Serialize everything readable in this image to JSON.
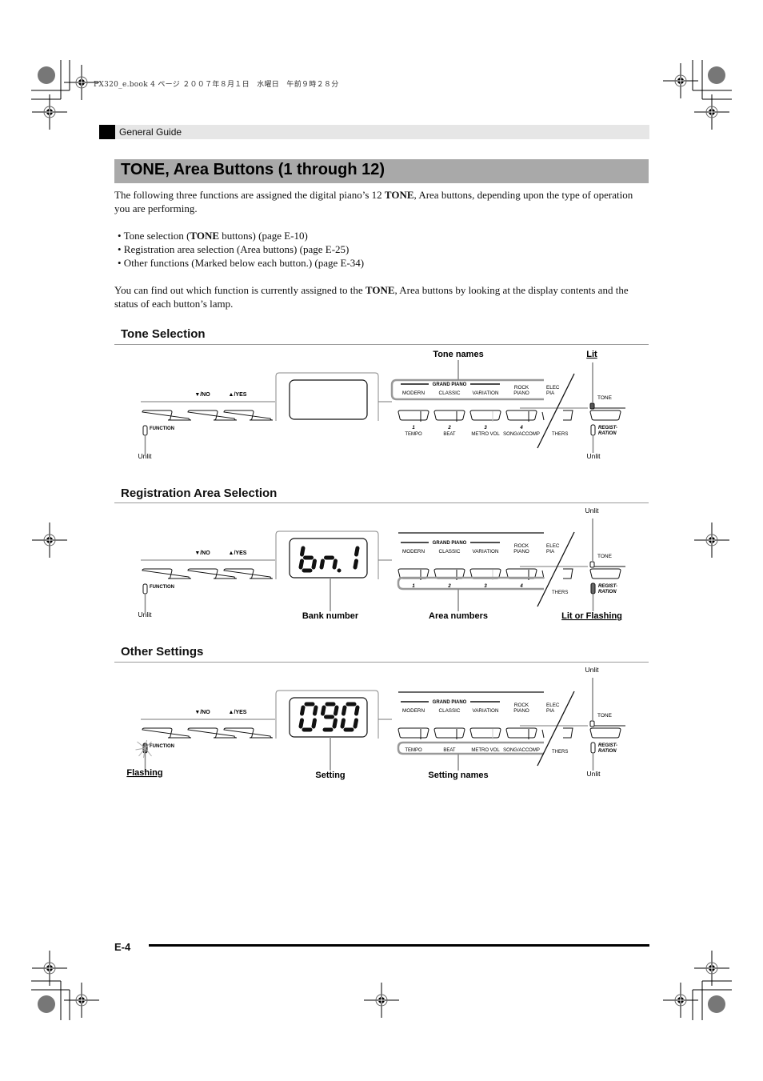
{
  "print_header": "PX320_e.book  4 ページ  ２００７年８月１日　水曜日　午前９時２８分",
  "section_label": "General Guide",
  "title": "TONE, Area Buttons (1 through 12)",
  "intro": {
    "part1": "The following three functions are assigned the digital piano’s 12 ",
    "bold": "TONE",
    "part2": ", Area buttons, depending upon the type of operation you are performing."
  },
  "bullets": [
    {
      "pre": "• Tone selection (",
      "bold": "TONE",
      "post": " buttons) (page E-10)"
    },
    {
      "pre": "• Registration area selection (Area buttons) (page E-25)",
      "bold": "",
      "post": ""
    },
    {
      "pre": "• Other functions (Marked below each button.) (page E-34)",
      "bold": "",
      "post": ""
    }
  ],
  "outro": {
    "part1": "You can find out which function is currently assigned to the ",
    "bold": "TONE",
    "part2": ", Area buttons by looking at the display contents and the status of each button’s lamp."
  },
  "panel": {
    "no_label": "▼/NO",
    "yes_label": "▲/YES",
    "function_label": "FUNCTION",
    "tone_label": "TONE",
    "regist_label_1": "REGIST-",
    "regist_label_2": "RATION",
    "grand_piano": "GRAND PIANO",
    "tone_names": [
      "MODERN",
      "CLASSIC",
      "VARIATION",
      "ROCK",
      "PIANO",
      "ELEC",
      "PIA"
    ],
    "area_numbers": [
      "1",
      "2",
      "3",
      "4"
    ],
    "setting_names": [
      "TEMPO",
      "BEAT",
      "METRO VOL",
      "SONG/ACCOMP",
      "THERS"
    ]
  },
  "sections": [
    {
      "heading": "Tone Selection",
      "display": "",
      "callouts": {
        "top_center": "Tone names",
        "top_right": "Lit",
        "bottom_left": "Unlit",
        "bottom_right": "Unlit"
      }
    },
    {
      "heading": "Registration Area Selection",
      "display": "bn.1",
      "callouts": {
        "top_right": "Unlit",
        "bottom_left": "Unlit",
        "display": "Bank number",
        "area": "Area numbers",
        "bottom_right": "Lit or Flashing"
      }
    },
    {
      "heading": "Other Settings",
      "display": "090",
      "callouts": {
        "top_right": "Unlit",
        "bottom_left": "Flashing",
        "display": "Setting",
        "area": "Setting names",
        "bottom_right": "Unlit"
      }
    }
  ],
  "page_number": "E-4"
}
